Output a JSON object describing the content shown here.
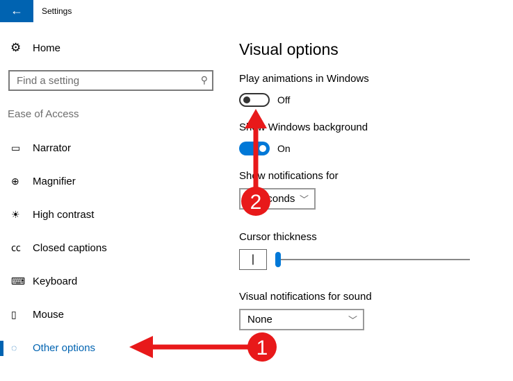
{
  "window": {
    "title": "Settings",
    "back_icon": "←"
  },
  "sidebar": {
    "home": "Home",
    "search_placeholder": "Find a setting",
    "section": "Ease of Access",
    "items": [
      {
        "label": "Narrator",
        "icon": "▭"
      },
      {
        "label": "Magnifier",
        "icon": "⊕"
      },
      {
        "label": "High contrast",
        "icon": "☀"
      },
      {
        "label": "Closed captions",
        "icon": "㏄"
      },
      {
        "label": "Keyboard",
        "icon": "⌨"
      },
      {
        "label": "Mouse",
        "icon": "▯"
      },
      {
        "label": "Other options",
        "icon": "◌"
      }
    ]
  },
  "main": {
    "title": "Visual options",
    "play_animations": {
      "label": "Play animations in Windows",
      "state": "Off"
    },
    "show_background": {
      "label": "Show Windows background",
      "state": "On"
    },
    "notifications": {
      "label": "Show notifications for",
      "value": "5 seconds"
    },
    "cursor": {
      "label": "Cursor thickness",
      "value": 1,
      "preview": "|"
    },
    "visual_sound": {
      "label": "Visual notifications for sound",
      "value": "None"
    }
  },
  "annotations": [
    "1",
    "2"
  ],
  "colors": {
    "accent": "#0078d7",
    "annotation": "#e8191a"
  }
}
